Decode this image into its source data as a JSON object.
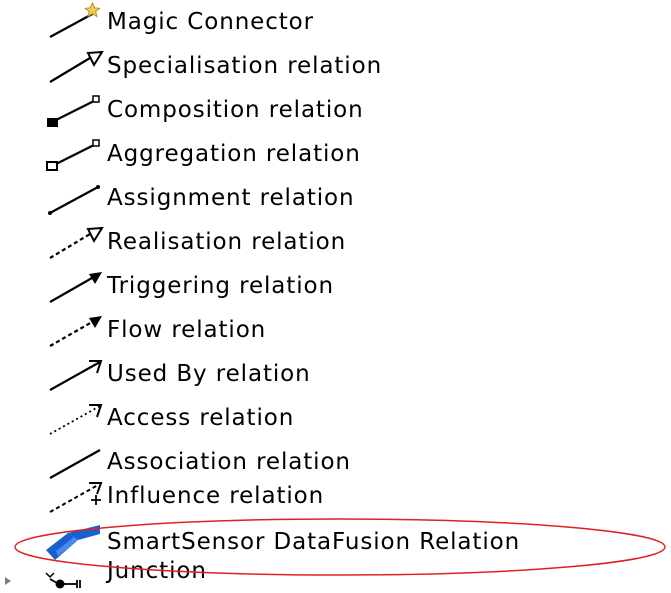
{
  "palette": {
    "items": [
      {
        "label": "Magic Connector",
        "icon": "magic-connector-icon"
      },
      {
        "label": "Specialisation relation",
        "icon": "specialisation-icon"
      },
      {
        "label": "Composition relation",
        "icon": "composition-icon"
      },
      {
        "label": "Aggregation relation",
        "icon": "aggregation-icon"
      },
      {
        "label": "Assignment relation",
        "icon": "assignment-icon"
      },
      {
        "label": "Realisation relation",
        "icon": "realisation-icon"
      },
      {
        "label": "Triggering relation",
        "icon": "triggering-icon"
      },
      {
        "label": "Flow relation",
        "icon": "flow-icon"
      },
      {
        "label": "Used By relation",
        "icon": "used-by-icon"
      },
      {
        "label": "Access relation",
        "icon": "access-icon"
      },
      {
        "label": "Association relation",
        "icon": "association-icon"
      },
      {
        "label": "Influence relation",
        "icon": "influence-icon"
      },
      {
        "label": "SmartSensor DataFusion Relation",
        "icon": "smartsensor-datafusion-icon"
      },
      {
        "label": "Junction",
        "icon": "junction-icon"
      }
    ],
    "highlighted_item": "SmartSensor DataFusion Relation"
  },
  "colors": {
    "highlight_ellipse": "#e02020",
    "smartsensor_icon_blue": "#1a5fd0",
    "magic_star": "#f2c94c"
  }
}
